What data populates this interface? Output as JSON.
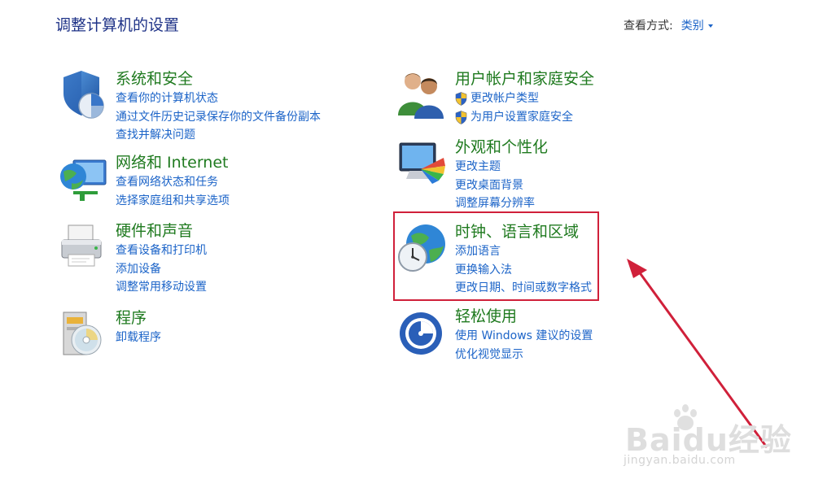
{
  "header": {
    "title": "调整计算机的设置",
    "view_by_label": "查看方式:",
    "view_by_value": "类别"
  },
  "categories": [
    {
      "title": "系统和安全",
      "icon": "security-shield-icon",
      "links": [
        "查看你的计算机状态",
        "通过文件历史记录保存你的文件备份副本",
        "查找并解决问题"
      ]
    },
    {
      "title": "网络和 Internet",
      "icon": "network-globe-icon",
      "links": [
        "查看网络状态和任务",
        "选择家庭组和共享选项"
      ]
    },
    {
      "title": "硬件和声音",
      "icon": "printer-icon",
      "links": [
        "查看设备和打印机",
        "添加设备",
        "调整常用移动设置"
      ]
    },
    {
      "title": "程序",
      "icon": "programs-disc-icon",
      "links": [
        "卸载程序"
      ]
    },
    {
      "title": "用户帐户和家庭安全",
      "icon": "users-icon",
      "links": [
        "更改帐户类型",
        "为用户设置家庭安全"
      ]
    },
    {
      "title": "外观和个性化",
      "icon": "monitor-palette-icon",
      "links": [
        "更改主题",
        "更改桌面背景",
        "调整屏幕分辨率"
      ]
    },
    {
      "title": "时钟、语言和区域",
      "icon": "globe-clock-icon",
      "links": [
        "添加语言",
        "更换输入法",
        "更改日期、时间或数字格式"
      ]
    },
    {
      "title": "轻松使用",
      "icon": "ease-of-access-icon",
      "links": [
        "使用 Windows 建议的设置",
        "优化视觉显示"
      ]
    }
  ],
  "annotation": {
    "highlight_color": "#d0203a"
  },
  "watermark": {
    "main": "Baidu经验",
    "sub": "jingyan.baidu.com"
  },
  "colors": {
    "title_blue": "#1e3287",
    "category_green": "#1f7a1f",
    "link_blue": "#1c64c8"
  }
}
